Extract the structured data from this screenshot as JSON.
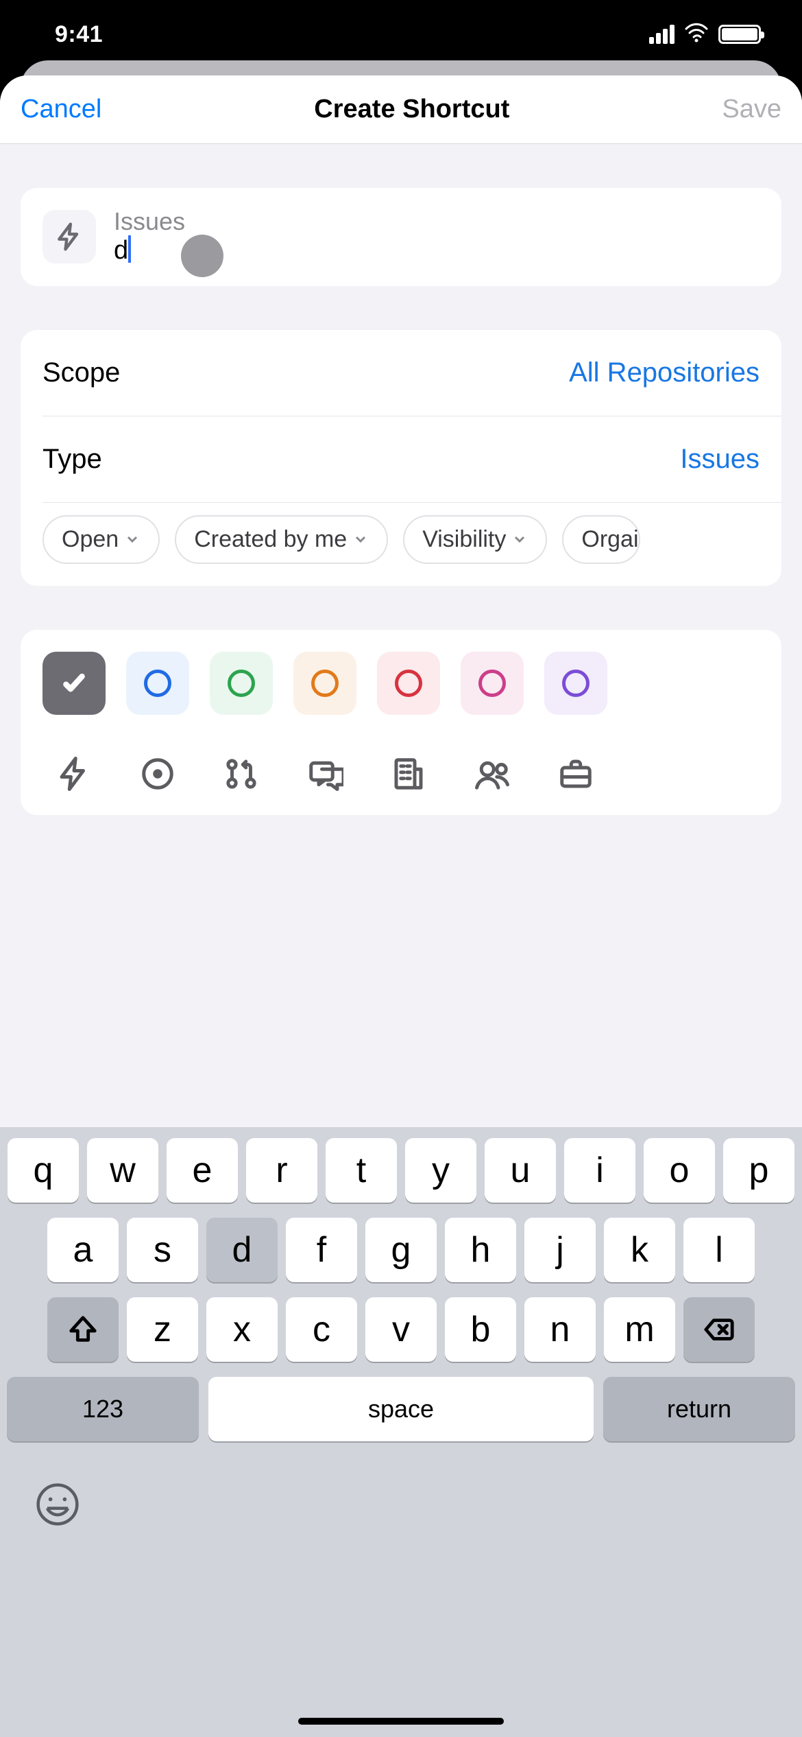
{
  "status": {
    "time": "9:41"
  },
  "nav": {
    "cancel": "Cancel",
    "title": "Create Shortcut",
    "save": "Save"
  },
  "name_field": {
    "placeholder": "Issues",
    "value": "d"
  },
  "rows": {
    "scope": {
      "label": "Scope",
      "value": "All Repositories"
    },
    "type": {
      "label": "Type",
      "value": "Issues"
    }
  },
  "chips": {
    "open": "Open",
    "created_by_me": "Created by me",
    "visibility": "Visibility",
    "organization": "Organization"
  },
  "colors": {
    "selected": "#6c6c72",
    "options_ring": [
      "#206be5",
      "#2ca44e",
      "#e27a1a",
      "#d83340",
      "#cc3e8a",
      "#7b4dd6"
    ],
    "options_bg": [
      "#eaf2fd",
      "#eaf7ee",
      "#fcf1e7",
      "#fceaec",
      "#faeaf2",
      "#f2ecfb"
    ]
  },
  "icons": [
    "bolt",
    "issue",
    "pull-request",
    "discussion",
    "organization",
    "people",
    "briefcase"
  ],
  "keyboard": {
    "row1": [
      "q",
      "w",
      "e",
      "r",
      "t",
      "y",
      "u",
      "i",
      "o",
      "p"
    ],
    "row2": [
      "a",
      "s",
      "d",
      "f",
      "g",
      "h",
      "j",
      "k",
      "l"
    ],
    "row3": [
      "z",
      "x",
      "c",
      "v",
      "b",
      "n",
      "m"
    ],
    "numbers": "123",
    "space": "space",
    "return": "return",
    "pressed_key": "d"
  }
}
